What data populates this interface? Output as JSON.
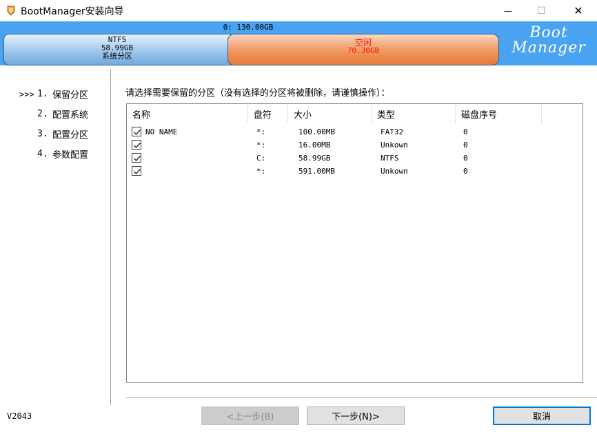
{
  "window": {
    "title": "BootManager安装向导",
    "minimize_glyph": "—",
    "maximize_glyph": "☐",
    "close_glyph": "✕"
  },
  "disk": {
    "label": "0: 130.00GB",
    "partitions": [
      {
        "fs": "NTFS",
        "size": "58.99GB",
        "name": "系统分区"
      },
      {
        "fs": "空闲",
        "size": "70.30GB"
      }
    ],
    "brand_line1": "Boot",
    "brand_line2": "Manager"
  },
  "steps": [
    {
      "marker": ">>>",
      "num": "1.",
      "label": "保留分区"
    },
    {
      "marker": "",
      "num": "2.",
      "label": "配置系统"
    },
    {
      "marker": "",
      "num": "3.",
      "label": "配置分区"
    },
    {
      "marker": "",
      "num": "4.",
      "label": "参数配置"
    }
  ],
  "instruction": "请选择需要保留的分区（没有选择的分区将被删除，请谨慎操作）：",
  "table": {
    "columns": [
      "名称",
      "盘符",
      "大小",
      "类型",
      "磁盘序号"
    ],
    "rows": [
      {
        "checked": true,
        "name": "NO NAME",
        "drive": "*:",
        "size": "100.00MB",
        "type": "FAT32",
        "disk": "0"
      },
      {
        "checked": true,
        "name": "",
        "drive": "*:",
        "size": "16.00MB",
        "type": "Unkown",
        "disk": "0"
      },
      {
        "checked": true,
        "name": "",
        "drive": "C:",
        "size": "58.99GB",
        "type": "NTFS",
        "disk": "0"
      },
      {
        "checked": true,
        "name": "",
        "drive": "*:",
        "size": "591.00MB",
        "type": "Unkown",
        "disk": "0"
      }
    ]
  },
  "footer": {
    "version": "V2043",
    "prev_label": "<上一步(B)",
    "next_label": "下一步(N)>",
    "cancel_label": "取消"
  },
  "colors": {
    "diskbar": "#4aa3f0",
    "free_text": "#ff1a00",
    "cancel_border": "#0078d7"
  }
}
